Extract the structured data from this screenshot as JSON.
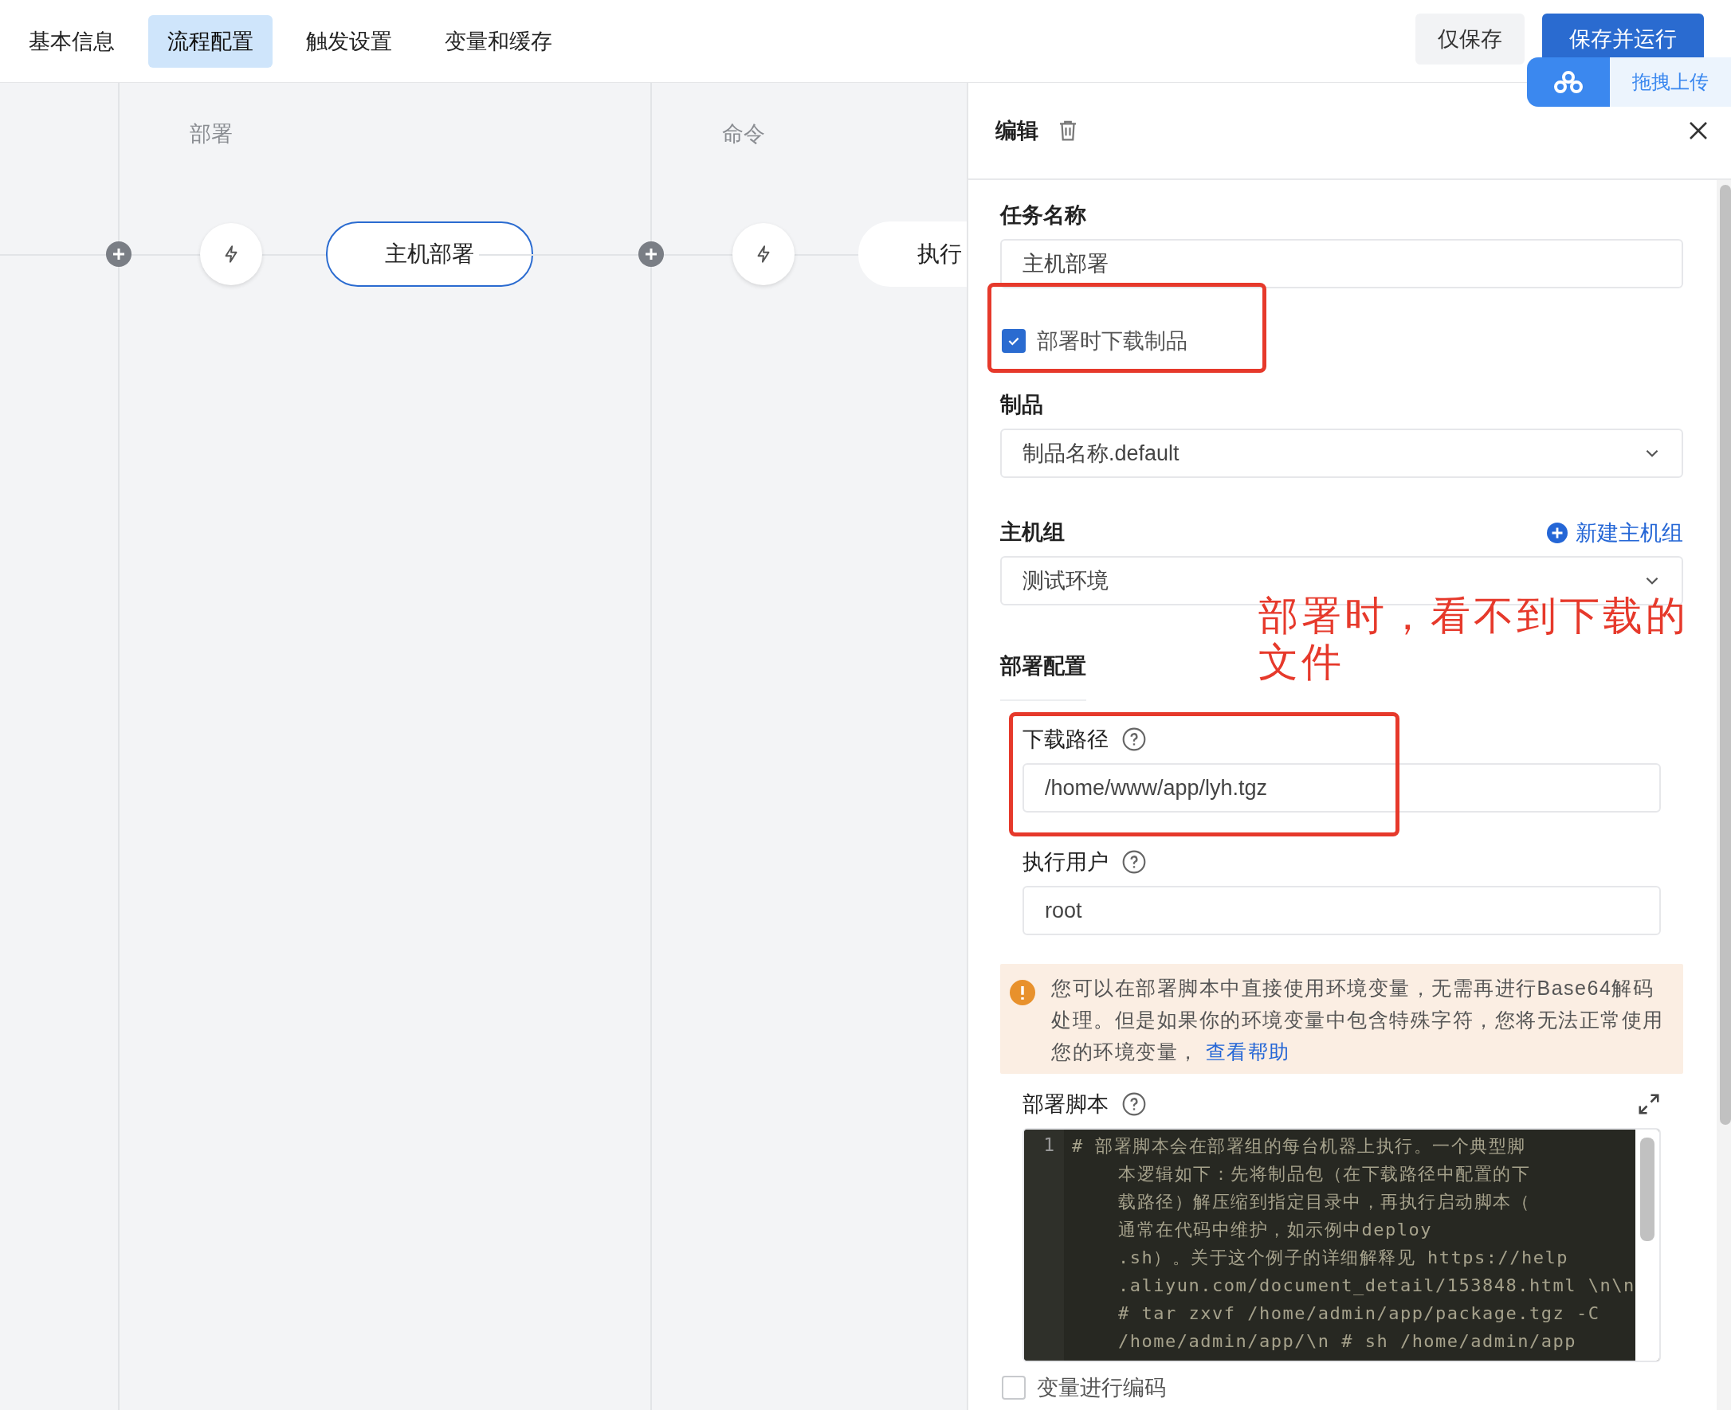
{
  "tabs": [
    {
      "label": "基本信息",
      "selected": false
    },
    {
      "label": "流程配置",
      "selected": true
    },
    {
      "label": "触发设置",
      "selected": false
    },
    {
      "label": "变量和缓存",
      "selected": false
    }
  ],
  "actions": {
    "save": "仅保存",
    "save_run": "保存并运行"
  },
  "upload_widget": {
    "label": "拖拽上传"
  },
  "canvas": {
    "stages": [
      {
        "title": "部署",
        "node": "主机部署",
        "selected": true
      },
      {
        "title": "命令",
        "node": "执行",
        "selected": false
      }
    ]
  },
  "panel": {
    "title": "编辑",
    "task_name": {
      "label": "任务名称",
      "value": "主机部署"
    },
    "download_artifact": {
      "label": "部署时下载制品",
      "checked": true
    },
    "artifact": {
      "label": "制品",
      "value": "制品名称.default"
    },
    "host_group": {
      "label": "主机组",
      "link": "新建主机组",
      "value": "测试环境"
    },
    "deploy_config": {
      "label": "部署配置",
      "download_path": {
        "label": "下载路径",
        "value": "/home/www/app/lyh.tgz"
      },
      "run_user": {
        "label": "执行用户",
        "value": "root"
      }
    },
    "alert": {
      "text": "您可以在部署脚本中直接使用环境变量，无需再进行Base64解码处理。但是如果你的环境变量中包含特殊字符，您将无法正常使用您的环境变量，",
      "link": "查看帮助"
    },
    "script": {
      "label": "部署脚本",
      "line_number": "1",
      "lines": [
        "# 部署脚本会在部署组的每台机器上执行。一个典型脚",
        "本逻辑如下：先将制品包（在下载路径中配置的下",
        "载路径）解压缩到指定目录中，再执行启动脚本（",
        "通常在代码中维护，如示例中deploy",
        ".sh）。关于这个例子的详细解释见 https://help",
        ".aliyun.com/document_detail/153848.html \\n\\n",
        "# tar zxvf /home/admin/app/package.tgz -C",
        "/home/admin/app/\\n # sh /home/admin/app"
      ]
    },
    "encode_vars": {
      "label": "变量进行编码",
      "checked": false
    }
  },
  "annotation": {
    "text": "部署时，看不到下载的文件"
  }
}
